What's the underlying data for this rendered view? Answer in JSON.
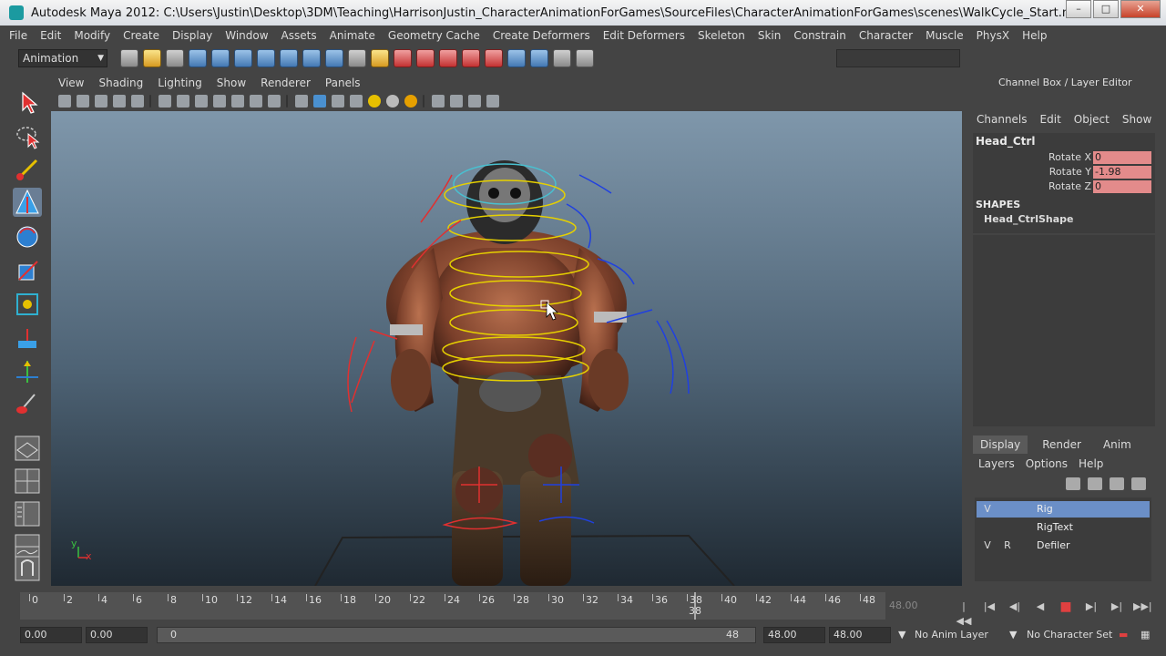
{
  "window": {
    "title": "Autodesk Maya 2012: C:\\Users\\Justin\\Desktop\\3DM\\Teaching\\HarrisonJustin_CharacterAnimationForGames\\SourceFiles\\CharacterAnimationForGames\\scenes\\WalkCycle_Start.ma*  ---  Head_Ctrl..."
  },
  "menubar": [
    "File",
    "Edit",
    "Modify",
    "Create",
    "Display",
    "Window",
    "Assets",
    "Animate",
    "Geometry Cache",
    "Create Deformers",
    "Edit Deformers",
    "Skeleton",
    "Skin",
    "Constrain",
    "Character",
    "Muscle",
    "PhysX",
    "Help"
  ],
  "mode_selector": {
    "value": "Animation"
  },
  "viewport": {
    "menu": [
      "View",
      "Shading",
      "Lighting",
      "Show",
      "Renderer",
      "Panels"
    ],
    "axis_y": "y",
    "axis_x": "x"
  },
  "channel_box": {
    "title": "Channel Box / Layer Editor",
    "menu": [
      "Channels",
      "Edit",
      "Object",
      "Show"
    ],
    "node": "Head_Ctrl",
    "channels": [
      {
        "label": "Rotate X",
        "value": "0"
      },
      {
        "label": "Rotate Y",
        "value": "-1.98"
      },
      {
        "label": "Rotate Z",
        "value": "0"
      }
    ],
    "shapes_header": "SHAPES",
    "shape_name": "Head_CtrlShape"
  },
  "layer_editor": {
    "tabs": [
      "Display",
      "Render",
      "Anim"
    ],
    "menu": [
      "Layers",
      "Options",
      "Help"
    ],
    "layers": [
      {
        "v": "V",
        "r": "",
        "name": "Rig"
      },
      {
        "v": "",
        "r": "",
        "name": "RigText"
      },
      {
        "v": "V",
        "r": "R",
        "name": "Defiler"
      }
    ]
  },
  "timeline": {
    "ticks": [
      "0",
      "2",
      "4",
      "6",
      "8",
      "10",
      "12",
      "14",
      "16",
      "18",
      "20",
      "22",
      "24",
      "26",
      "28",
      "30",
      "32",
      "34",
      "36",
      "38",
      "40",
      "42",
      "44",
      "46",
      "48"
    ],
    "current_frame": "38",
    "playback_end": "48.00"
  },
  "range": {
    "start_time": "0.00",
    "playback_start": "0.00",
    "slider_start": "0",
    "slider_end": "48",
    "playback_end": "48.00",
    "end_time": "48.00",
    "anim_layer": "No Anim Layer",
    "character_set": "No Character Set"
  }
}
